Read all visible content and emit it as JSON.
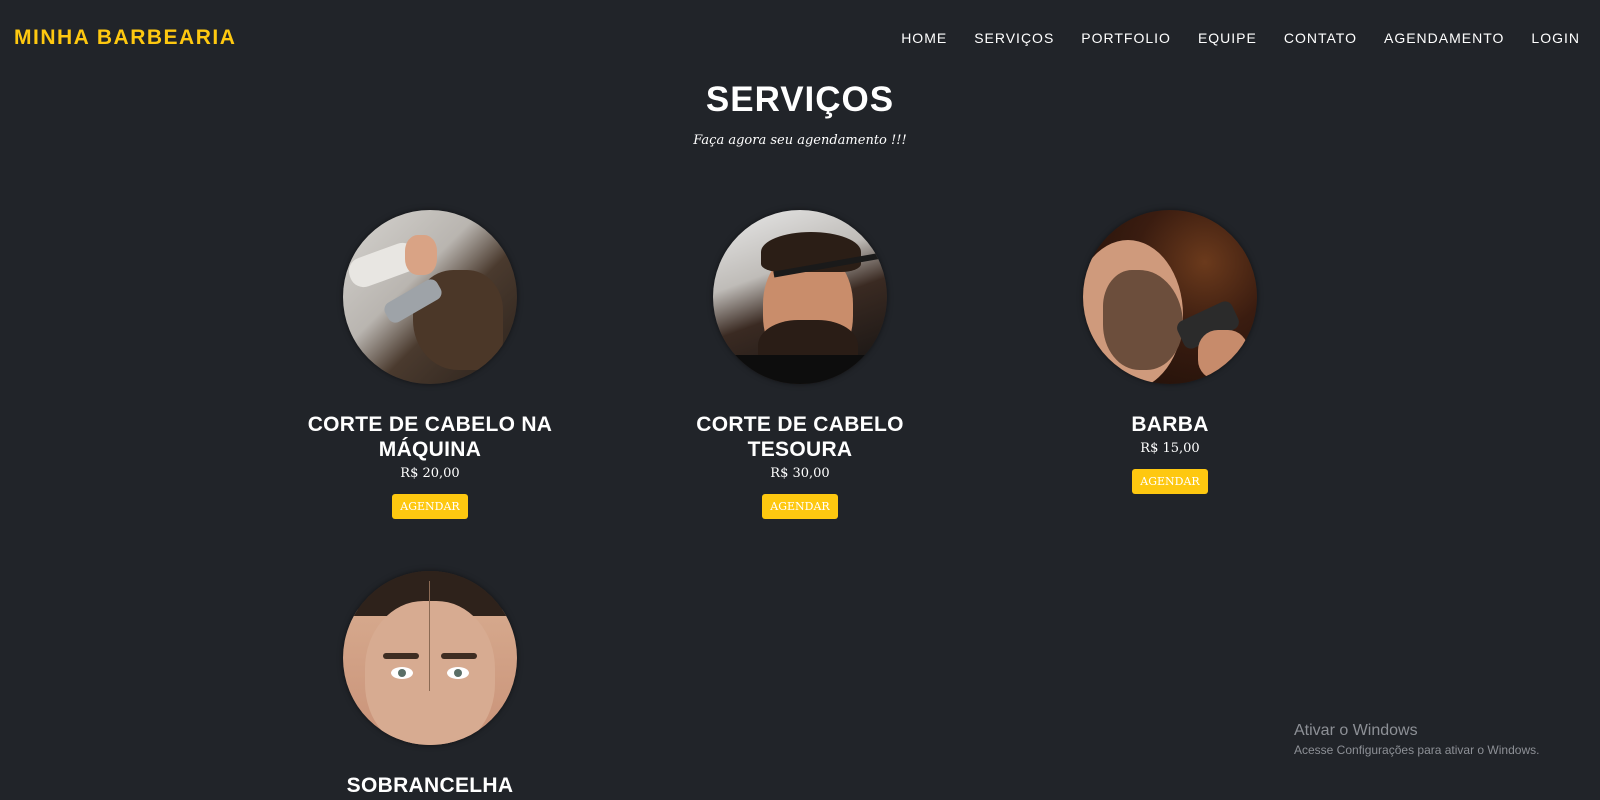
{
  "navbar": {
    "brand": "MINHA BARBEARIA",
    "links": [
      "HOME",
      "SERVIÇOS",
      "PORTFOLIO",
      "EQUIPE",
      "CONTATO",
      "AGENDAMENTO",
      "LOGIN"
    ]
  },
  "services": {
    "title": "SERVIÇOS",
    "subtitle": "Faça agora seu agendamento !!!",
    "items": [
      {
        "title": "CORTE DE CABELO NA MÁQUINA",
        "price": "R$ 20,00",
        "button": "AGENDAR",
        "image": "haircut-machine-photo"
      },
      {
        "title": "CORTE DE CABELO TESOURA",
        "price": "R$ 30,00",
        "button": "AGENDAR",
        "image": "haircut-scissors-photo"
      },
      {
        "title": "BARBA",
        "price": "R$ 15,00",
        "button": "AGENDAR",
        "image": "beard-photo"
      },
      {
        "title": "SOBRANCELHA",
        "image": "eyebrow-photo"
      }
    ]
  },
  "watermark": {
    "title": "Ativar o Windows",
    "text": "Acesse Configurações para ativar o Windows."
  },
  "colors": {
    "background": "#212429",
    "accent": "#fec810",
    "text": "#ffffff"
  }
}
